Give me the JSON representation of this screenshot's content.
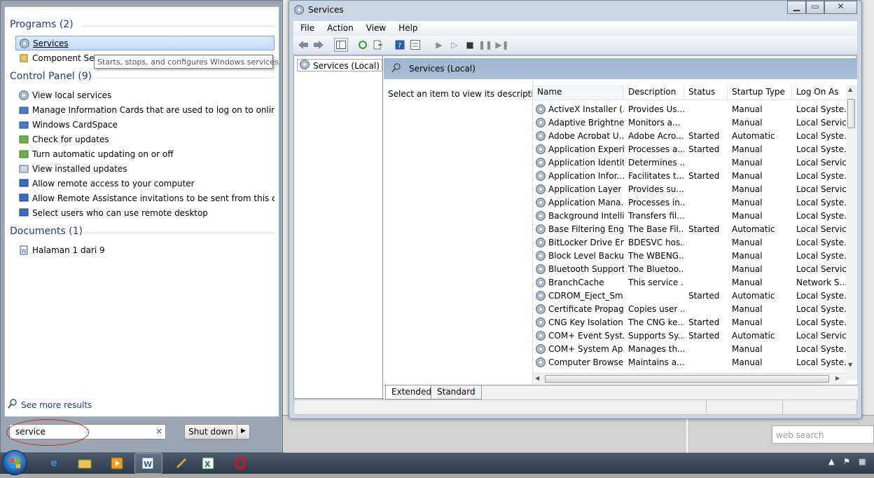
{
  "start_menu": {
    "programs_header": "Programs (2)",
    "programs": [
      "Services",
      "Component Servi"
    ],
    "tooltip": "Starts, stops, and configures Windows services.",
    "control_panel_header": "Control Panel (9)",
    "control_panel": [
      "View local services",
      "Manage Information Cards that are used to log on to online ser...",
      "Windows CardSpace",
      "Check for updates",
      "Turn automatic updating on or off",
      "View installed updates",
      "Allow remote access to your computer",
      "Allow Remote Assistance invitations to be sent from this comp...",
      "Select users who can use remote desktop"
    ],
    "documents_header": "Documents (1)",
    "documents": [
      "Halaman 1 dari 9"
    ],
    "see_more": "See more results",
    "search_value": "service",
    "search_clear": "×",
    "shutdown_label": "Shut down",
    "shutdown_arrow": "▶"
  },
  "window": {
    "title": "Services",
    "menu": [
      "File",
      "Action",
      "View",
      "Help"
    ],
    "tree_item": "Services (Local)",
    "header": "Services (Local)",
    "description_prompt": "Select an item to view its description.",
    "columns": [
      "Name",
      "Description",
      "Status",
      "Startup Type",
      "Log On As"
    ],
    "rows": [
      [
        "ActiveX Installer (...",
        "Provides Us...",
        "",
        "Manual",
        "Local Syste..."
      ],
      [
        "Adaptive Brightness",
        "Monitors a...",
        "",
        "Manual",
        "Local Service"
      ],
      [
        "Adobe Acrobat U...",
        "Adobe Acro...",
        "Started",
        "Automatic",
        "Local Syste..."
      ],
      [
        "Application Experi...",
        "Processes a...",
        "Started",
        "Manual",
        "Local Syste..."
      ],
      [
        "Application Identity",
        "Determines ...",
        "",
        "Manual",
        "Local Service"
      ],
      [
        "Application Infor...",
        "Facilitates t...",
        "Started",
        "Manual",
        "Local Syste..."
      ],
      [
        "Application Layer ...",
        "Provides su...",
        "",
        "Manual",
        "Local Service"
      ],
      [
        "Application Mana...",
        "Processes in...",
        "",
        "Manual",
        "Local Syste..."
      ],
      [
        "Background Intelli...",
        "Transfers fil...",
        "",
        "Manual",
        "Local Syste..."
      ],
      [
        "Base Filtering Engi...",
        "The Base Fil...",
        "Started",
        "Automatic",
        "Local Service"
      ],
      [
        "BitLocker Drive En...",
        "BDESVC hos...",
        "",
        "Manual",
        "Local Syste..."
      ],
      [
        "Block Level Backu...",
        "The WBENG...",
        "",
        "Manual",
        "Local Syste..."
      ],
      [
        "Bluetooth Support...",
        "The Bluetoo...",
        "",
        "Manual",
        "Local Service"
      ],
      [
        "BranchCache",
        "This service ...",
        "",
        "Manual",
        "Network S..."
      ],
      [
        "CDROM_Eject_Sm...",
        "",
        "Started",
        "Automatic",
        "Local Syste..."
      ],
      [
        "Certificate Propag...",
        "Copies user ...",
        "",
        "Manual",
        "Local Syste..."
      ],
      [
        "CNG Key Isolation",
        "The CNG ke...",
        "Started",
        "Manual",
        "Local Syste..."
      ],
      [
        "COM+ Event Syst...",
        "Supports Sy...",
        "Started",
        "Automatic",
        "Local Service"
      ],
      [
        "COM+ System Ap...",
        "Manages th...",
        "",
        "Manual",
        "Local Syste..."
      ],
      [
        "Computer Browser",
        "Maintains a...",
        "",
        "Manual",
        "Local Syste..."
      ]
    ],
    "tabs": [
      "Extended",
      "Standard"
    ]
  },
  "background": {
    "web_search_placeholder": "web search"
  },
  "colors": {
    "section_header": "#1e3c8c",
    "selection": "#c1dbfc",
    "window_frame": "#c9d7e6",
    "panel_header": "#a9bfd7"
  }
}
